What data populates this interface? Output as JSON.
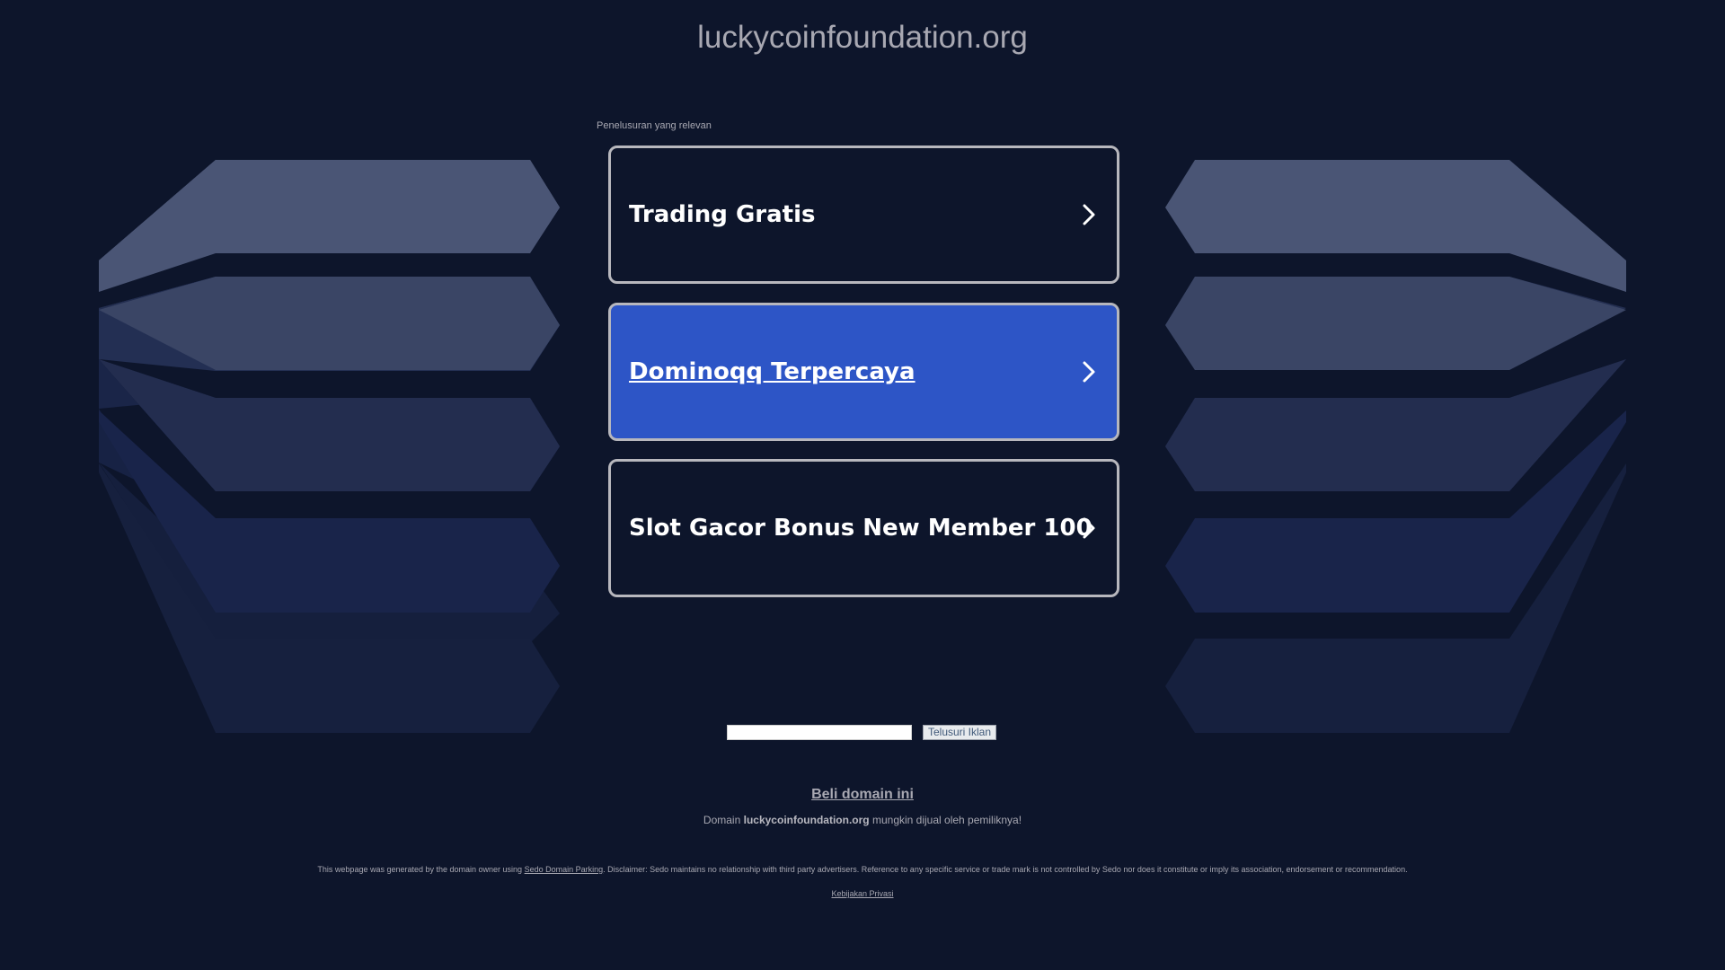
{
  "header": {
    "domain_title": "luckycoinfoundation.org"
  },
  "related": {
    "label": "Penelusuran yang relevan",
    "links": [
      {
        "label": "Trading Gratis",
        "active": false
      },
      {
        "label": "Dominoqq Terpercaya",
        "active": true
      },
      {
        "label": "Slot Gacor Bonus New Member 100",
        "active": false
      }
    ]
  },
  "search": {
    "input_value": "",
    "button_label": "Telusuri Iklan"
  },
  "sale": {
    "buy_link": "Beli domain ini",
    "prefix": "Domain",
    "domain": "luckycoinfoundation.org",
    "suffix": "mungkin dijual oleh pemiliknya!"
  },
  "footer": {
    "disclaimer_before": "This webpage was generated by the domain owner using",
    "disclaimer_link": "Sedo Domain Parking",
    "disclaimer_after": ". Disclaimer: Sedo maintains no relationship with third party advertisers. Reference to any specific service or trade mark is not controlled by Sedo nor does it constitute or imply its association, endorsement or recommendation.",
    "privacy_link": "Kebijakan Privasi"
  },
  "colors": {
    "background": "#0d152b",
    "active_card": "#2d55c6",
    "card_border": "#b7b7bd",
    "text_muted": "#a8a8b2"
  },
  "icons": {
    "card_arrow": "chevron-right-icon"
  }
}
